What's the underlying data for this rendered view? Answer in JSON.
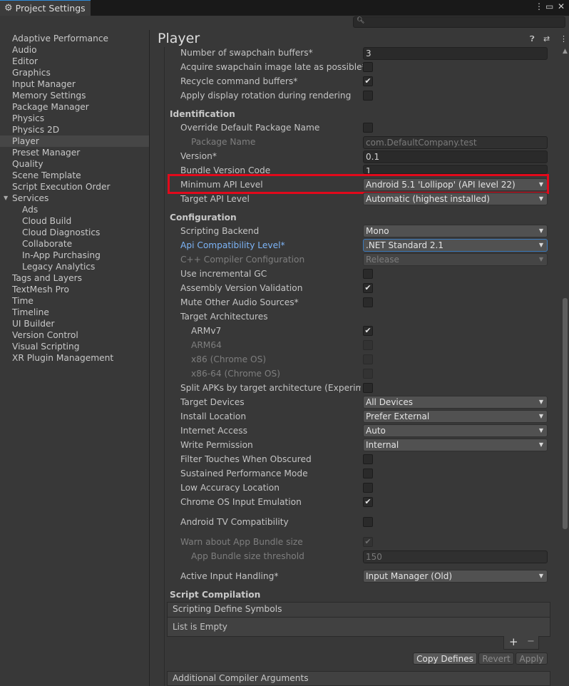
{
  "window": {
    "tab_title": "Project Settings",
    "menu_icon": "kebab-menu-icon",
    "maximize_icon": "maximize-icon",
    "close_icon": "close-icon"
  },
  "search": {
    "icon": "search-icon",
    "value": ""
  },
  "sidebar": {
    "items": [
      "Adaptive Performance",
      "Audio",
      "Editor",
      "Graphics",
      "Input Manager",
      "Memory Settings",
      "Package Manager",
      "Physics",
      "Physics 2D",
      "Player",
      "Preset Manager",
      "Quality",
      "Scene Template",
      "Script Execution Order",
      "Services",
      "Ads",
      "Cloud Build",
      "Cloud Diagnostics",
      "Collaborate",
      "In-App Purchasing",
      "Legacy Analytics",
      "Tags and Layers",
      "TextMesh Pro",
      "Time",
      "Timeline",
      "UI Builder",
      "Version Control",
      "Visual Scripting",
      "XR Plugin Management"
    ],
    "selected": "Player"
  },
  "player": {
    "title": "Player",
    "help_icon": "help-icon",
    "preset_icon": "preset-icon",
    "more_icon": "kebab-menu-icon",
    "rows_top": {
      "swapchain_label": "Number of swapchain buffers*",
      "swapchain_value": "3",
      "acquire_label": "Acquire swapchain image late as possible*",
      "recycle_label": "Recycle command buffers*",
      "rotation_label": "Apply display rotation during rendering"
    },
    "identification": {
      "header": "Identification",
      "override_label": "Override Default Package Name",
      "package_label": "Package Name",
      "package_value": "com.DefaultCompany.test",
      "version_label": "Version*",
      "version_value": "0.1",
      "bundle_label": "Bundle Version Code",
      "bundle_value": "1",
      "min_api_label": "Minimum API Level",
      "min_api_value": "Android 5.1 'Lollipop' (API level 22)",
      "target_api_label": "Target API Level",
      "target_api_value": "Automatic (highest installed)"
    },
    "configuration": {
      "header": "Configuration",
      "backend_label": "Scripting Backend",
      "backend_value": "Mono",
      "api_compat_label": "Api Compatibility Level*",
      "api_compat_value": ".NET Standard 2.1",
      "cpp_label": "C++ Compiler Configuration",
      "cpp_value": "Release",
      "incremental_label": "Use incremental GC",
      "assembly_label": "Assembly Version Validation",
      "mute_label": "Mute Other Audio Sources*",
      "arch_label": "Target Architectures",
      "armv7_label": "ARMv7",
      "arm64_label": "ARM64",
      "x86_label": "x86 (Chrome OS)",
      "x8664_label": "x86-64 (Chrome OS)",
      "split_label": "Split APKs by target architecture (Experimental)",
      "devices_label": "Target Devices",
      "devices_value": "All Devices",
      "install_label": "Install Location",
      "install_value": "Prefer External",
      "internet_label": "Internet Access",
      "internet_value": "Auto",
      "write_label": "Write Permission",
      "write_value": "Internal",
      "filter_label": "Filter Touches When Obscured",
      "sustained_label": "Sustained Performance Mode",
      "low_acc_label": "Low Accuracy Location",
      "chromeos_label": "Chrome OS Input Emulation",
      "tv_label": "Android TV Compatibility",
      "warn_label": "Warn about App Bundle size",
      "threshold_label": "App Bundle size threshold",
      "threshold_value": "150",
      "input_label": "Active Input Handling*",
      "input_value": "Input Manager (Old)"
    },
    "script_compilation": {
      "header": "Script Compilation",
      "defines_header": "Scripting Define Symbols",
      "list_empty": "List is Empty",
      "add_label": "+",
      "remove_label": "−",
      "copy_label": "Copy Defines",
      "revert_label": "Revert",
      "apply_label": "Apply",
      "compiler_args_header": "Additional Compiler Arguments"
    }
  }
}
